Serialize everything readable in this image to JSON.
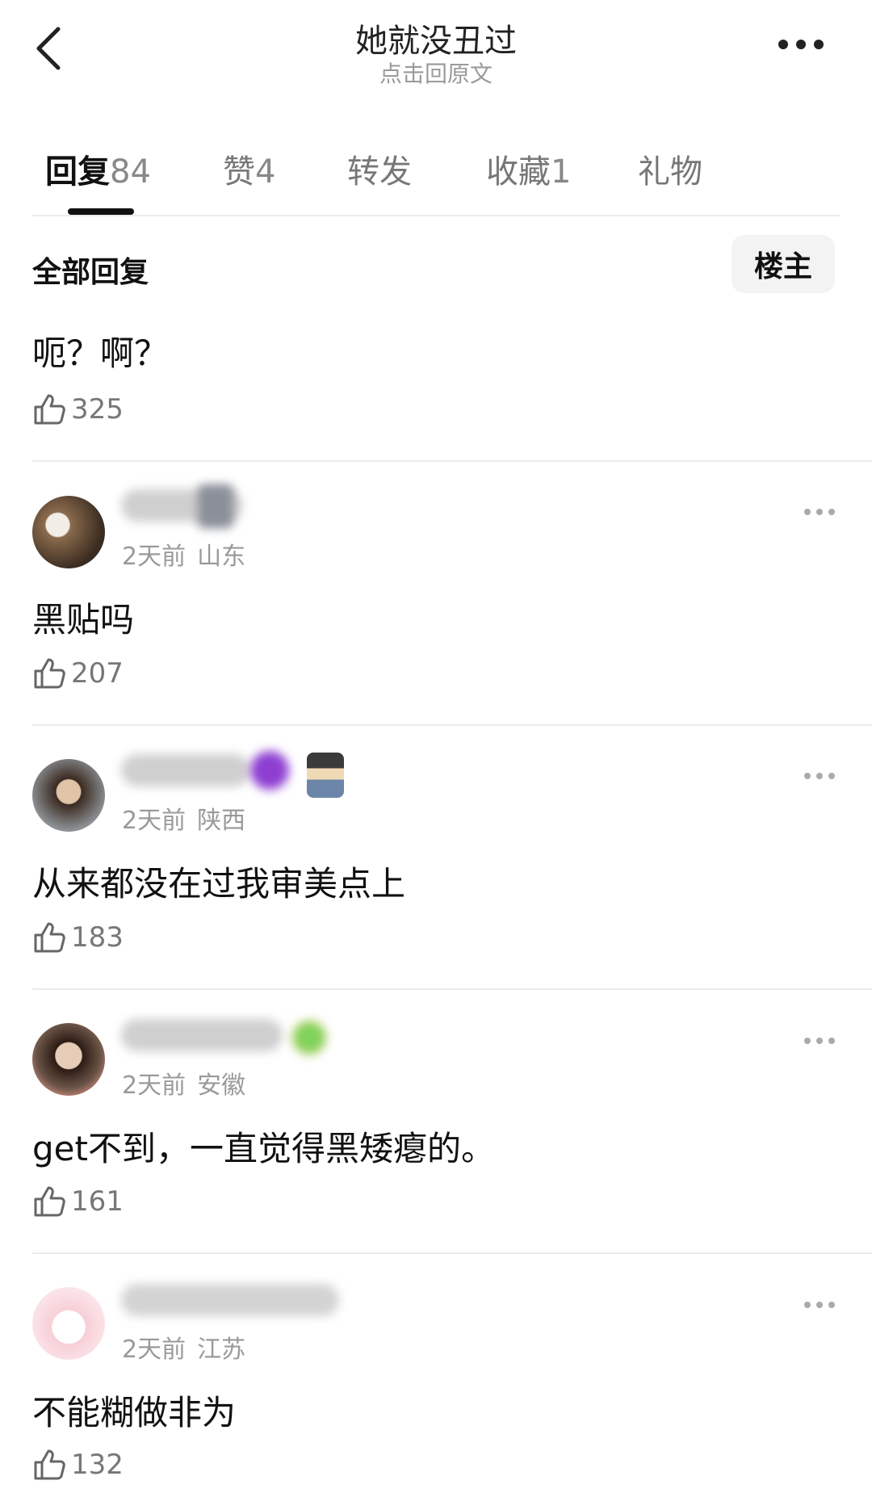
{
  "header": {
    "title": "她就没丑过",
    "subtitle": "点击回原文"
  },
  "tabs": [
    {
      "label": "回复",
      "count": "84"
    },
    {
      "label": "赞",
      "count": "4"
    },
    {
      "label": "转发",
      "count": ""
    },
    {
      "label": "收藏",
      "count": "1"
    },
    {
      "label": "礼物",
      "count": ""
    }
  ],
  "filter": {
    "all_label": "全部回复",
    "owner_label": "楼主"
  },
  "comments": [
    {
      "text": "呃？啊？",
      "likes": "325"
    },
    {
      "time": "2天前",
      "location": "山东",
      "text": "黑贴吗",
      "likes": "207"
    },
    {
      "time": "2天前",
      "location": "陕西",
      "text": "从来都没在过我审美点上",
      "likes": "183"
    },
    {
      "time": "2天前",
      "location": "安徽",
      "text": "get不到，一直觉得黑矮瘪的。",
      "likes": "161"
    },
    {
      "time": "2天前",
      "location": "江苏",
      "text": "不能糊做非为",
      "likes": "132"
    }
  ]
}
